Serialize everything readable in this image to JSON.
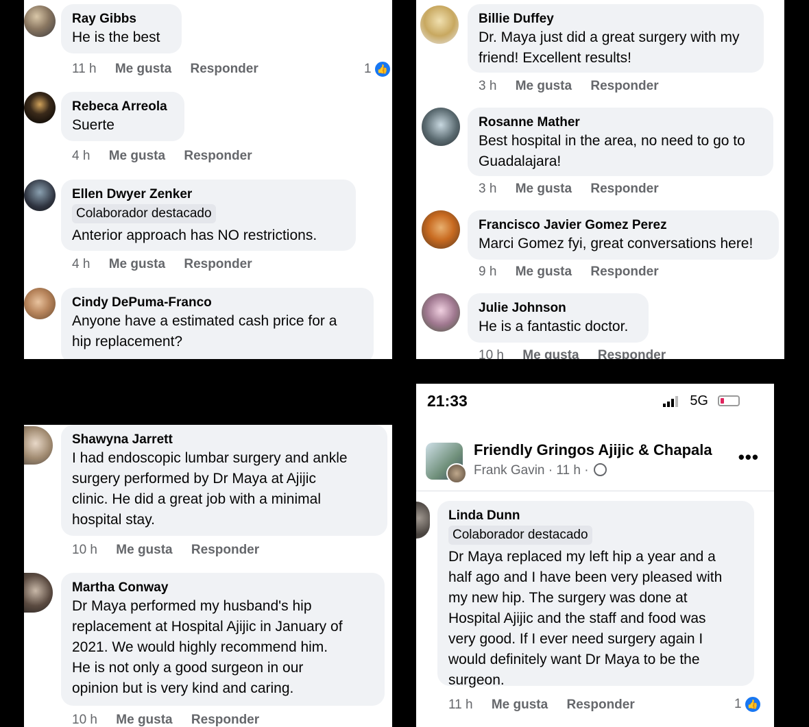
{
  "panel1": {
    "comments": [
      {
        "author": "Ray Gibbs",
        "text": "He is the best",
        "time": "11 h",
        "like": "Me gusta",
        "reply": "Responder",
        "reactions": "1"
      },
      {
        "author": "Rebeca Arreola",
        "text": "Suerte",
        "time": "4 h",
        "like": "Me gusta",
        "reply": "Responder"
      },
      {
        "author": "Ellen Dwyer Zenker",
        "badge": "Colaborador destacado",
        "text": "Anterior approach has NO restrictions.",
        "time": "4 h",
        "like": "Me gusta",
        "reply": "Responder"
      },
      {
        "author": "Cindy DePuma-Franco",
        "text_lines": [
          "Anyone have a estimated cash price for a",
          "hip replacement?"
        ]
      }
    ]
  },
  "panel2": {
    "comments": [
      {
        "author": "Billie Duffey",
        "text_lines": [
          "Dr. Maya just did a great surgery with my",
          "friend! Excellent results!"
        ],
        "time": "3 h",
        "like": "Me gusta",
        "reply": "Responder"
      },
      {
        "author": "Rosanne Mather",
        "text_lines": [
          "Best hospital in the area, no need  to go to",
          "Guadalajara!"
        ],
        "time": "3 h",
        "like": "Me gusta",
        "reply": "Responder"
      },
      {
        "author": "Francisco Javier Gomez Perez",
        "text": "Marci Gomez fyi, great conversations here!",
        "time": "9 h",
        "like": "Me gusta",
        "reply": "Responder"
      },
      {
        "author": "Julie Johnson",
        "text": "He is a fantastic doctor.",
        "time": "10 h",
        "like": "Me gusta",
        "reply": "Responder"
      }
    ]
  },
  "panel3": {
    "comments": [
      {
        "author": "Shawyna Jarrett",
        "text_lines": [
          "I had endoscopic lumbar surgery and ankle",
          "surgery performed by Dr Maya at Ajijic",
          "clinic.  He did a great job with a minimal",
          "hospital stay."
        ],
        "time": "10 h",
        "like": "Me gusta",
        "reply": "Responder"
      },
      {
        "author": "Martha Conway",
        "text_lines": [
          "Dr Maya performed my husband's hip",
          "replacement at Hospital Ajijic in January of",
          "2021.   We would highly recommend him.",
          "He is not only a good surgeon in our",
          "opinion but is very kind and caring."
        ],
        "time": "10 h",
        "like": "Me gusta",
        "reply": "Responder"
      }
    ]
  },
  "panel4": {
    "status": {
      "time": "21:33",
      "network": "5G"
    },
    "group": {
      "title": "Friendly Gringos Ajijic & Chapala",
      "subtitle": "Frank Gavin · 11 h ·",
      "more": "•••"
    },
    "comment": {
      "author": "Linda Dunn",
      "badge": "Colaborador destacado",
      "text_lines": [
        "Dr Maya replaced my left hip a year and a",
        "half ago and I have been very pleased with",
        "my new hip. The surgery was done at",
        "Hospital Ajijic and the staff and food was",
        "very good. If I ever need surgery again I",
        "would definitely want Dr Maya to be the",
        "surgeon."
      ],
      "time": "11 h",
      "like": "Me gusta",
      "reply": "Responder",
      "reactions": "1"
    }
  }
}
